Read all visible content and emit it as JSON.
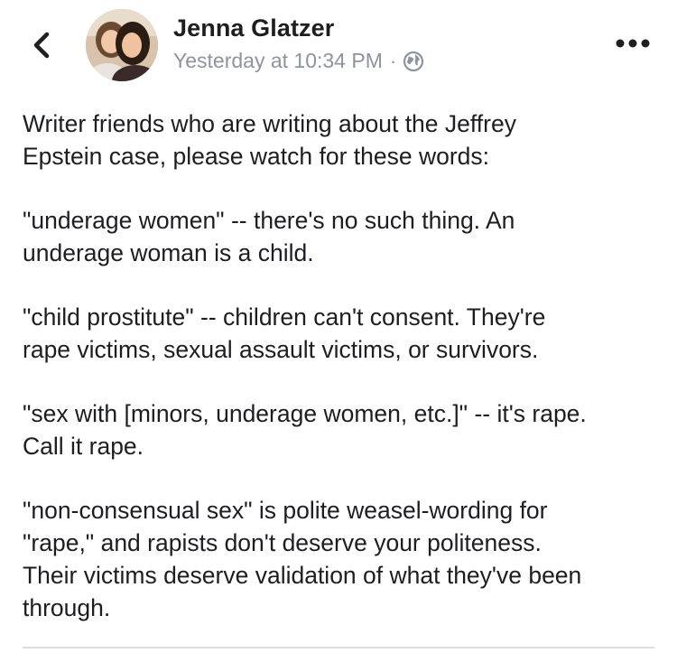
{
  "header": {
    "back_icon": "chevron-left-icon",
    "author_name": "Jenna Glatzer",
    "timestamp": "Yesterday at 10:34 PM",
    "separator": "·",
    "privacy_icon": "globe-icon",
    "more_icon": "more-horizontal-icon"
  },
  "post": {
    "paragraphs": [
      [
        "Writer friends who are writing about the Jeffrey",
        "Epstein case, please watch for these words:"
      ],
      [
        "\"underage women\" -- there's no such thing. An",
        "underage woman is a child."
      ],
      [
        "\"child prostitute\" -- children can't consent. They're",
        "rape victims, sexual assault victims, or survivors."
      ],
      [
        "\"sex with [minors, underage women, etc.]\" -- it's rape.",
        "Call it rape."
      ],
      [
        "\"non-consensual sex\" is polite weasel-wording for",
        "\"rape,\" and rapists don't deserve your politeness.",
        "Their victims deserve validation of what they've been",
        "through."
      ]
    ]
  },
  "colors": {
    "text": "#1c1e21",
    "meta": "#8d949e",
    "divider": "#dadde1"
  }
}
